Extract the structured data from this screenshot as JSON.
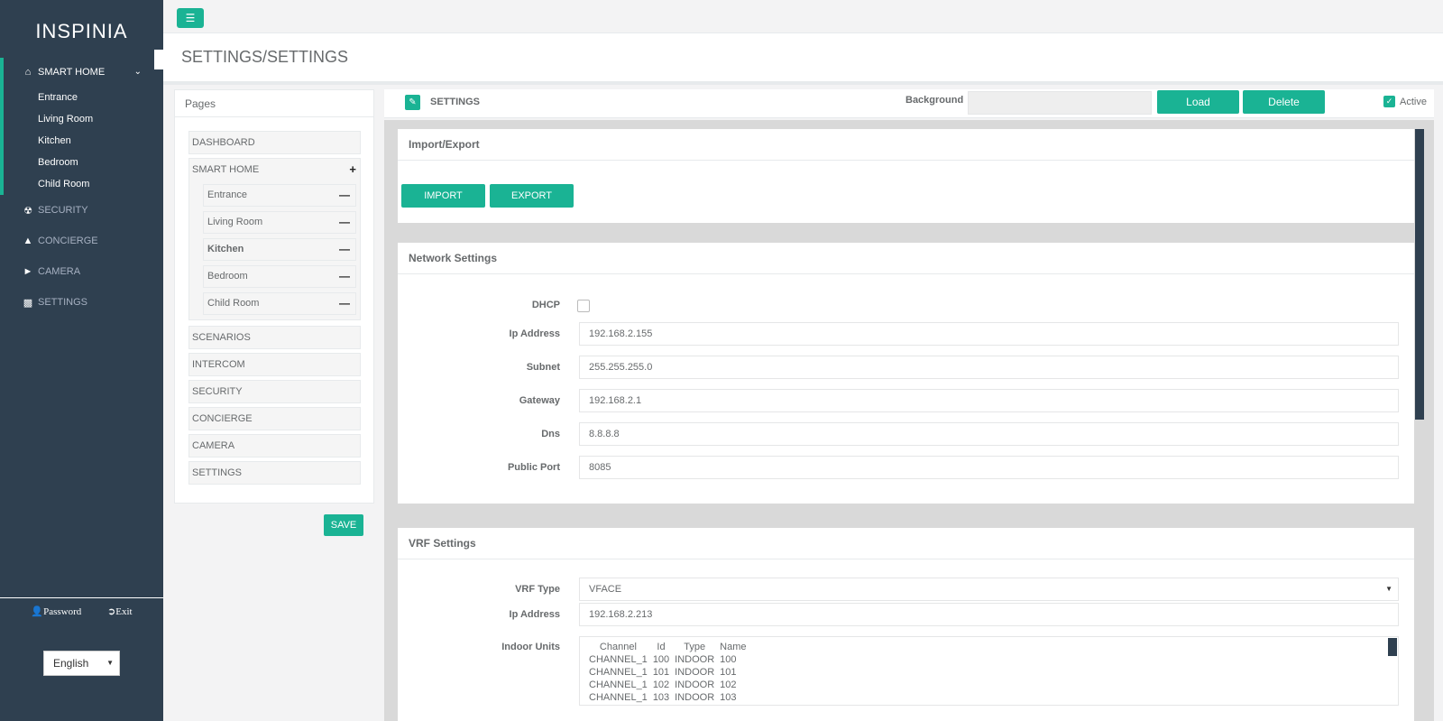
{
  "sidebar": {
    "logo": "INSPINIA",
    "menu": [
      {
        "label": "SMART HOME",
        "icon": "home-icon"
      },
      {
        "label": "SECURITY",
        "icon": "security-icon"
      },
      {
        "label": "CONCIERGE",
        "icon": "concierge-icon"
      },
      {
        "label": "CAMERA",
        "icon": "camera-icon"
      },
      {
        "label": "SETTINGS",
        "icon": "settings-icon"
      }
    ],
    "submenu": [
      "Entrance",
      "Living Room",
      "Kitchen",
      "Bedroom",
      "Child Room"
    ],
    "password": "Password",
    "exit": "Exit",
    "language": "English"
  },
  "heading": {
    "title": "SETTINGS/SETTINGS"
  },
  "pages": {
    "title": "Pages",
    "items": [
      "DASHBOARD",
      "SMART HOME",
      "SCENARIOS",
      "INTERCOM",
      "SECURITY",
      "CONCIERGE",
      "CAMERA",
      "SETTINGS"
    ],
    "sub": [
      "Entrance",
      "Living Room",
      "Kitchen",
      "Bedroom",
      "Child Room"
    ],
    "save": "SAVE"
  },
  "main": {
    "title": "SETTINGS",
    "background_label": "Background",
    "load": "Load",
    "delete": "Delete",
    "active": "Active"
  },
  "import_export": {
    "title": "Import/Export",
    "import": "IMPORT",
    "export": "EXPORT"
  },
  "network": {
    "title": "Network Settings",
    "dhcp_label": "DHCP",
    "dhcp_checked": false,
    "ip_label": "Ip Address",
    "ip": "192.168.2.155",
    "subnet_label": "Subnet",
    "subnet": "255.255.255.0",
    "gateway_label": "Gateway",
    "gateway": "192.168.2.1",
    "dns_label": "Dns",
    "dns": "8.8.8.8",
    "port_label": "Public Port",
    "port": "8085"
  },
  "vrf": {
    "title": "VRF Settings",
    "type_label": "VRF Type",
    "type": "VFACE",
    "ip_label": "Ip Address",
    "ip": "192.168.2.213",
    "units_label": "Indoor Units",
    "headers": [
      "Channel",
      "Id",
      "Type",
      "Name"
    ],
    "rows": [
      [
        "CHANNEL_1",
        "100",
        "INDOOR",
        "100"
      ],
      [
        "CHANNEL_1",
        "101",
        "INDOOR",
        "101"
      ],
      [
        "CHANNEL_1",
        "102",
        "INDOOR",
        "102"
      ],
      [
        "CHANNEL_1",
        "103",
        "INDOOR",
        "103"
      ]
    ]
  },
  "colors": {
    "accent": "#1ab394",
    "sidebar": "#2f4050"
  }
}
